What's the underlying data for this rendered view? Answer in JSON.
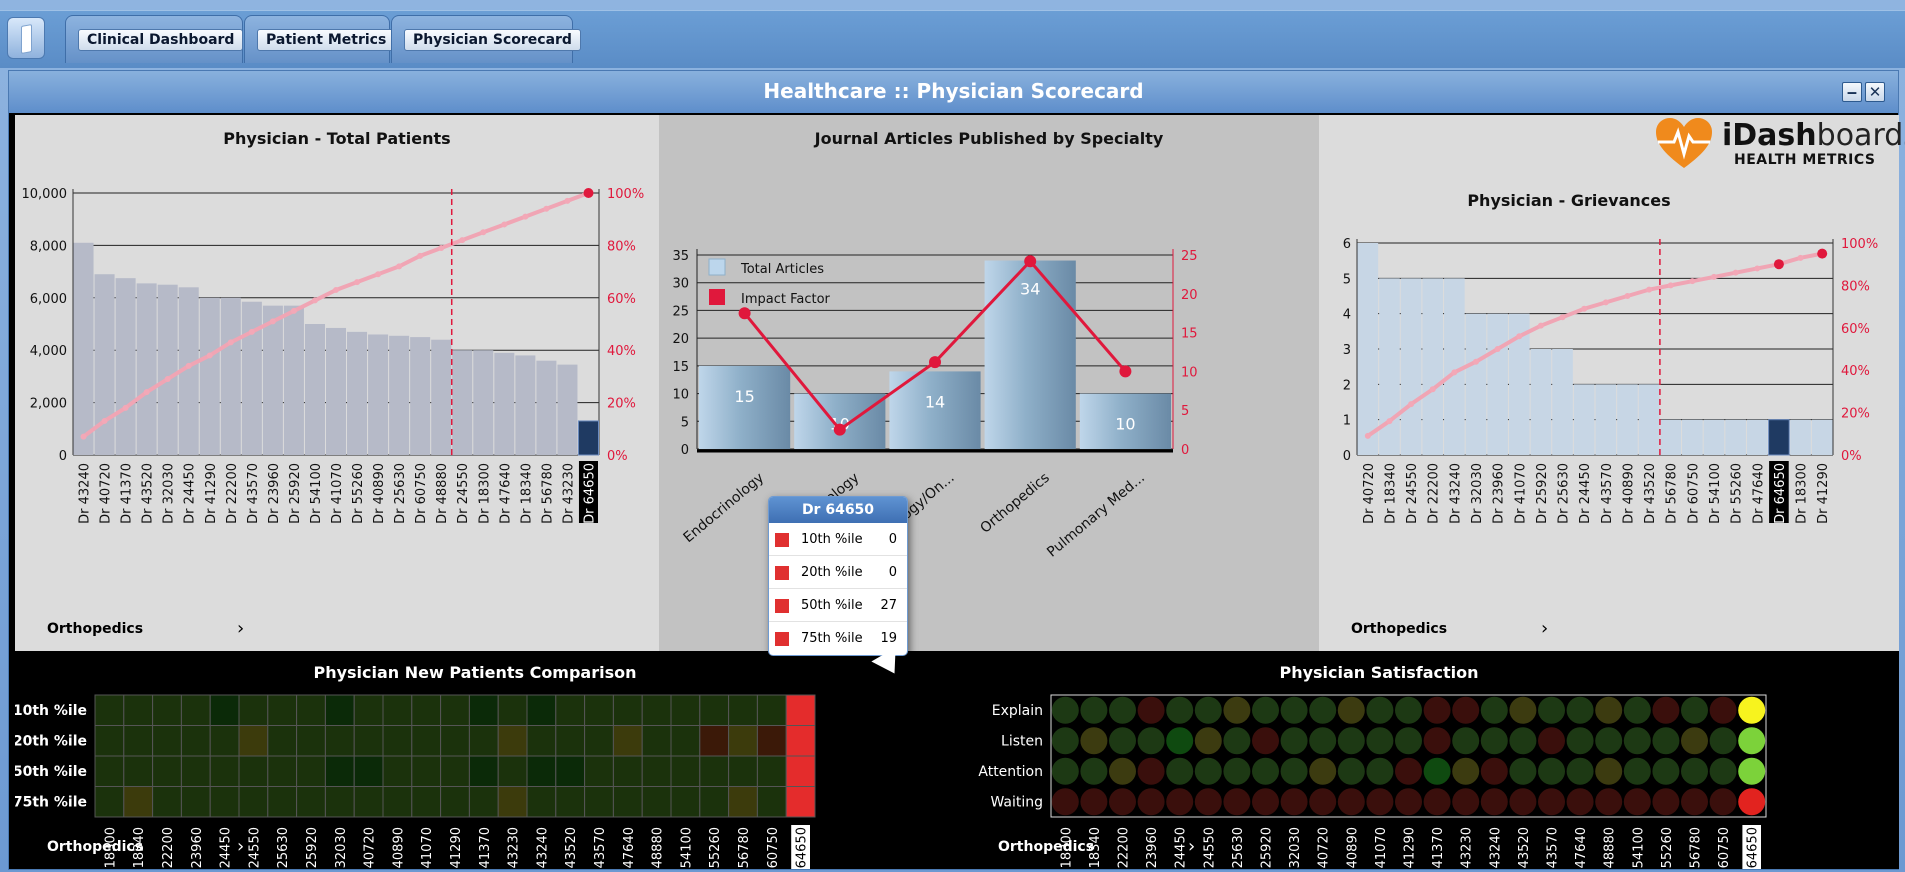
{
  "tabs": [
    "Clinical Dashboard",
    "Patient Metrics",
    "Physician Scorecard"
  ],
  "window_title": "Healthcare :: Physician Scorecard",
  "window_buttons": {
    "minimize": "‒",
    "close": "✕"
  },
  "logo": {
    "brand_a": "iDash",
    "brand_b": "boards",
    "sub": "HEALTH METRICS"
  },
  "colors": {
    "accent_red": "#e0183c",
    "tab_blue": "#6b9ed5",
    "bar_gray": "#b6bac8",
    "selected_bar": "#1f3a62"
  },
  "total_patients": {
    "title": "Physician - Total Patients",
    "dropdown": "Orthopedics",
    "chart_data": {
      "type": "bar",
      "categories": [
        "Dr 43240",
        "Dr 40720",
        "Dr 41370",
        "Dr 43520",
        "Dr 32030",
        "Dr 24450",
        "Dr 41290",
        "Dr 22200",
        "Dr 43570",
        "Dr 23960",
        "Dr 25920",
        "Dr 54100",
        "Dr 41070",
        "Dr 55260",
        "Dr 40890",
        "Dr 25630",
        "Dr 60750",
        "Dr 48880",
        "Dr 24550",
        "Dr 18300",
        "Dr 47640",
        "Dr 18340",
        "Dr 56780",
        "Dr 43230",
        "Dr 64650"
      ],
      "values": [
        8100,
        6900,
        6750,
        6550,
        6500,
        6400,
        6000,
        6000,
        5850,
        5700,
        5700,
        5000,
        4850,
        4700,
        4600,
        4550,
        4500,
        4400,
        4000,
        4000,
        3900,
        3800,
        3600,
        3450,
        1300
      ],
      "cumulative_pct": [
        7,
        13,
        18,
        24,
        29,
        34,
        38,
        43,
        47,
        51,
        55,
        59,
        63,
        66,
        69,
        72,
        76,
        79,
        82,
        85,
        88,
        91,
        94,
        97,
        100
      ],
      "highlighted": "Dr 64650",
      "ylim": [
        0,
        10000
      ],
      "yticks": [
        "0",
        "2,000",
        "4,000",
        "6,000",
        "8,000",
        "10,000"
      ],
      "y2ticks": [
        "0%",
        "20%",
        "40%",
        "60%",
        "80%",
        "100%"
      ]
    }
  },
  "journal": {
    "title": "Journal Articles Published by Specialty",
    "legend": [
      "Total Articles",
      "Impact Factor"
    ],
    "chart_data": {
      "type": "bar",
      "categories": [
        "Endocrinology",
        "Neurology",
        "Hematology/On...",
        "Orthopedics",
        "Pulmonary Med..."
      ],
      "categories_visible": [
        "Endocrinology",
        "ology",
        "matology/On...",
        "Orthopedics",
        "Pulmonary Med..."
      ],
      "series": [
        {
          "name": "Total Articles",
          "values": [
            15,
            10,
            14,
            34,
            10
          ]
        },
        {
          "name": "Impact Factor",
          "values": [
            17.5,
            2.5,
            11.2,
            24.2,
            10
          ]
        }
      ],
      "ylim": [
        0,
        35
      ],
      "y2lim": [
        0,
        25
      ],
      "yticks": [
        "0",
        "5",
        "10",
        "15",
        "20",
        "25",
        "30",
        "35"
      ],
      "y2ticks": [
        "0",
        "5",
        "10",
        "15",
        "20",
        "25"
      ]
    }
  },
  "grievances": {
    "title": "Physician - Grievances",
    "dropdown": "Orthopedics",
    "chart_data": {
      "type": "bar",
      "categories": [
        "Dr 40720",
        "Dr 18340",
        "Dr 24550",
        "Dr 22200",
        "Dr 43240",
        "Dr 32030",
        "Dr 23960",
        "Dr 41070",
        "Dr 25920",
        "Dr 25630",
        "Dr 24450",
        "Dr 43570",
        "Dr 40890",
        "Dr 43520",
        "Dr 56780",
        "Dr 60750",
        "Dr 54100",
        "Dr 55260",
        "Dr 47640",
        "Dr 64650",
        "Dr 18300",
        "Dr 41290"
      ],
      "values": [
        6,
        5,
        5,
        5,
        5,
        4,
        4,
        4,
        3,
        3,
        2,
        2,
        2,
        2,
        1,
        1,
        1,
        1,
        1,
        1,
        1,
        1
      ],
      "cumulative_pct": [
        9,
        16,
        24,
        31,
        39,
        44,
        50,
        56,
        61,
        65,
        69,
        72,
        75,
        78,
        80,
        82,
        84,
        86,
        88,
        90,
        93,
        95
      ],
      "highlighted": "Dr 64650",
      "ylim": [
        0,
        6
      ],
      "yticks": [
        "0",
        "1",
        "2",
        "3",
        "4",
        "5",
        "6"
      ],
      "y2ticks": [
        "0%",
        "20%",
        "40%",
        "60%",
        "80%",
        "100%"
      ]
    }
  },
  "new_patients": {
    "title": "Physician New Patients Comparison",
    "dropdown": "Orthopedics",
    "rows": [
      "10th %ile",
      "20th %ile",
      "50th %ile",
      "75th %ile"
    ],
    "columns": [
      "Dr 18300",
      "Dr 18340",
      "Dr 22200",
      "Dr 23960",
      "Dr 24450",
      "Dr 24550",
      "Dr 25630",
      "Dr 25920",
      "Dr 32030",
      "Dr 40720",
      "Dr 40890",
      "Dr 41070",
      "Dr 41290",
      "Dr 41370",
      "Dr 43230",
      "Dr 43240",
      "Dr 43520",
      "Dr 43570",
      "Dr 47640",
      "Dr 48880",
      "Dr 54100",
      "Dr 55260",
      "Dr 56780",
      "Dr 60750",
      "Dr 64650"
    ],
    "chart_data": {
      "type": "heatmap",
      "intensity": [
        [
          1,
          1,
          1,
          1,
          0,
          1,
          1,
          1,
          0,
          1,
          1,
          1,
          1,
          0,
          1,
          0,
          1,
          1,
          1,
          1,
          1,
          1,
          1,
          1,
          4
        ],
        [
          1,
          1,
          1,
          1,
          1,
          2,
          1,
          1,
          1,
          1,
          1,
          1,
          1,
          1,
          2,
          1,
          1,
          1,
          2,
          1,
          1,
          3,
          2,
          3,
          4
        ],
        [
          1,
          1,
          1,
          1,
          1,
          1,
          1,
          1,
          0,
          0,
          1,
          1,
          1,
          0,
          1,
          0,
          0,
          1,
          1,
          1,
          1,
          1,
          1,
          1,
          4
        ],
        [
          1,
          2,
          1,
          1,
          1,
          1,
          1,
          1,
          1,
          1,
          1,
          1,
          1,
          1,
          2,
          1,
          1,
          1,
          1,
          1,
          1,
          1,
          2,
          1,
          4
        ]
      ]
    },
    "tooltip": {
      "header": "Dr 64650",
      "items": [
        {
          "label": "10th %ile",
          "value": "0"
        },
        {
          "label": "20th %ile",
          "value": "0"
        },
        {
          "label": "50th %ile",
          "value": "27"
        },
        {
          "label": "75th %ile",
          "value": "19"
        }
      ]
    }
  },
  "satisfaction": {
    "title": "Physician Satisfaction",
    "dropdown": "Orthopedics",
    "rows": [
      "Explain",
      "Listen",
      "Attention",
      "Waiting"
    ],
    "columns": [
      "Dr 18300",
      "Dr 18340",
      "Dr 22200",
      "Dr 23960",
      "Dr 24450",
      "Dr 24550",
      "Dr 25630",
      "Dr 25920",
      "Dr 32030",
      "Dr 40720",
      "Dr 40890",
      "Dr 41070",
      "Dr 41290",
      "Dr 41370",
      "Dr 43230",
      "Dr 43240",
      "Dr 43520",
      "Dr 43570",
      "Dr 47640",
      "Dr 48880",
      "Dr 54100",
      "Dr 55260",
      "Dr 56780",
      "Dr 60750",
      "Dr 64650"
    ],
    "chart_data": {
      "type": "heatmap",
      "status": [
        [
          "g",
          "g",
          "g",
          "r",
          "g",
          "g",
          "y",
          "g",
          "g",
          "g",
          "y",
          "g",
          "g",
          "r",
          "r",
          "g",
          "y",
          "g",
          "g",
          "y",
          "g",
          "r",
          "g",
          "r",
          "Y"
        ],
        [
          "g",
          "y",
          "g",
          "g",
          "d",
          "y",
          "g",
          "r",
          "g",
          "g",
          "g",
          "g",
          "g",
          "r",
          "g",
          "g",
          "g",
          "r",
          "g",
          "g",
          "g",
          "g",
          "y",
          "g",
          "G"
        ],
        [
          "g",
          "g",
          "y",
          "r",
          "g",
          "g",
          "g",
          "g",
          "g",
          "y",
          "g",
          "g",
          "r",
          "d",
          "y",
          "r",
          "g",
          "g",
          "g",
          "y",
          "g",
          "g",
          "g",
          "g",
          "G"
        ],
        [
          "r",
          "r",
          "r",
          "r",
          "r",
          "r",
          "r",
          "r",
          "r",
          "r",
          "r",
          "r",
          "r",
          "r",
          "r",
          "r",
          "r",
          "r",
          "r",
          "r",
          "r",
          "r",
          "r",
          "r",
          "R"
        ]
      ]
    }
  }
}
